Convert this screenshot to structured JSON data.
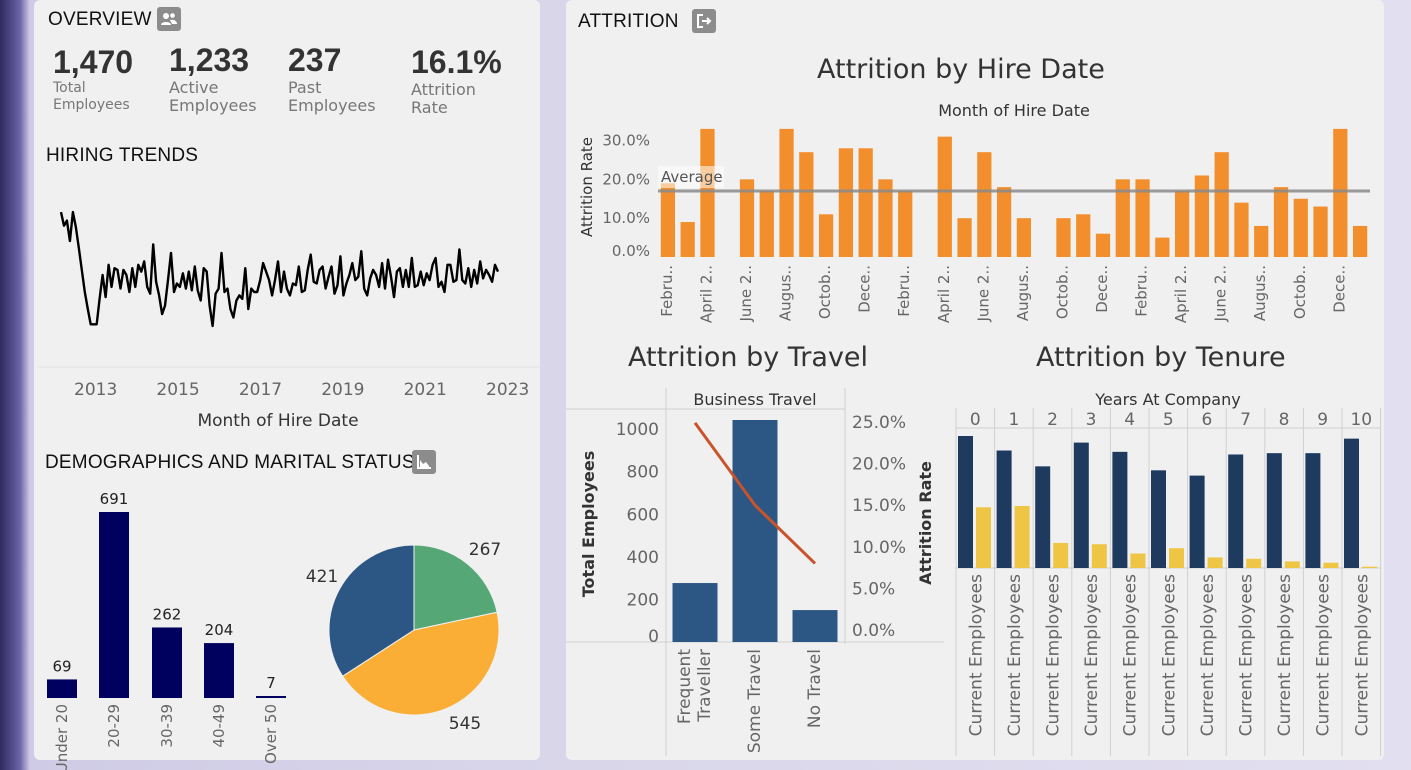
{
  "overview": {
    "title": "OVERVIEW",
    "kpis": [
      {
        "value": "1,470",
        "label_1": "Total",
        "label_2": "Employees"
      },
      {
        "value": "1,233",
        "label_1": "Active",
        "label_2": "Employees"
      },
      {
        "value": "237",
        "label_1": "Past",
        "label_2": "Employees"
      },
      {
        "value": "16.1%",
        "label_1": "Attrition",
        "label_2": "Rate"
      }
    ]
  },
  "hiring": {
    "title": "HIRING TRENDS"
  },
  "demographics": {
    "title": "DEMOGRAPHICS AND MARITAL STATUS"
  },
  "attrition": {
    "title": "ATTRITION"
  },
  "colors": {
    "orange": "#f28e2b",
    "navy": "#00005e",
    "steel": "#2c5785",
    "green": "#55a776",
    "amber": "#fbae35",
    "yellow": "#eec545",
    "line_red": "#c9532a"
  },
  "chart_data": [
    {
      "id": "hiring",
      "type": "line",
      "xlabel": "Month of Hire Date",
      "ylabel": "",
      "x_ticks": [
        "2013",
        "2015",
        "2017",
        "2019",
        "2021",
        "2023"
      ],
      "x_range": [
        2011.6,
        2023.3
      ],
      "y_range": [
        0,
        100
      ],
      "values": [
        87,
        79,
        82,
        70,
        87,
        78,
        66,
        53,
        40,
        30,
        21,
        21,
        21,
        36,
        50,
        37,
        56,
        43,
        54,
        53,
        42,
        53,
        50,
        40,
        54,
        43,
        56,
        52,
        58,
        43,
        39,
        68,
        46,
        38,
        27,
        32,
        47,
        63,
        40,
        45,
        43,
        51,
        42,
        52,
        41,
        55,
        41,
        35,
        54,
        52,
        32,
        20,
        39,
        42,
        63,
        40,
        42,
        30,
        25,
        35,
        38,
        36,
        54,
        30,
        42,
        40,
        40,
        47,
        57,
        52,
        47,
        38,
        47,
        58,
        40,
        52,
        42,
        38,
        45,
        44,
        55,
        40,
        41,
        53,
        62,
        46,
        45,
        53,
        55,
        42,
        49,
        55,
        39,
        44,
        61,
        38,
        45,
        50,
        57,
        47,
        49,
        64,
        42,
        38,
        48,
        53,
        50,
        43,
        57,
        42,
        59,
        49,
        37,
        52,
        54,
        43,
        53,
        43,
        60,
        43,
        44,
        52,
        44,
        51,
        47,
        56,
        60,
        43,
        46,
        40,
        56,
        56,
        46,
        47,
        65,
        47,
        45,
        54,
        43,
        53,
        45,
        58,
        48,
        53,
        50,
        46,
        56,
        52
      ],
      "grid": false
    },
    {
      "id": "age",
      "type": "bar",
      "categories": [
        "Under 20",
        "20-29",
        "30-39",
        "40-49",
        "Over 50"
      ],
      "values": [
        69,
        691,
        262,
        204,
        7
      ],
      "value_labels": [
        "69",
        "691",
        "262",
        "204",
        "7"
      ],
      "y_range": [
        0,
        691
      ]
    },
    {
      "id": "marital",
      "type": "pie",
      "values": [
        267,
        545,
        421
      ],
      "value_labels": [
        "267",
        "545",
        "421"
      ],
      "colors": [
        "#55a776",
        "#fbae35",
        "#2c5785"
      ]
    },
    {
      "id": "hire_attrition",
      "type": "bar",
      "title": "Attrition by Hire Date",
      "subtitle": "Month of Hire Date",
      "ylabel": "Attrition Rate",
      "y_ticks": [
        "0.0%",
        "10.0%",
        "20.0%",
        "30.0%"
      ],
      "y_range": [
        0,
        34
      ],
      "x_labels": [
        "Febru..",
        "April 2..",
        "June 2..",
        "Augus..",
        "Octob..",
        "Dece..",
        "Febru..",
        "April 2..",
        "June 2..",
        "Augus..",
        "Octob..",
        "Dece..",
        "Febru..",
        "April 2..",
        "June 2..",
        "Augus..",
        "Octob..",
        "Dece.."
      ],
      "values": [
        19,
        9,
        33,
        0,
        20,
        17,
        33,
        27,
        11,
        28,
        28,
        20,
        17,
        0,
        31,
        10,
        27,
        18,
        10,
        0,
        10,
        11,
        6,
        20,
        20,
        5,
        17,
        21,
        27,
        14,
        8,
        18,
        15,
        13,
        33,
        8
      ],
      "average": 17,
      "average_label": "Average"
    },
    {
      "id": "travel",
      "type": "bar",
      "title": "Attrition by Travel",
      "header": "Business Travel",
      "ylabel": "Total Employees",
      "ylabel_right": "Attrition Rate",
      "categories": [
        "Frequent Traveller",
        "Some Travel",
        "No Travel"
      ],
      "values": [
        277,
        1043,
        150
      ],
      "rate": [
        24.9,
        15.0,
        8.0
      ],
      "y_ticks": [
        "0",
        "200",
        "400",
        "600",
        "800",
        "1000"
      ],
      "y_range": [
        0,
        1043
      ],
      "y_ticks_right": [
        "0.0%",
        "5.0%",
        "10.0%",
        "15.0%",
        "20.0%",
        "25.0%"
      ],
      "y_range_right": [
        0,
        25
      ]
    },
    {
      "id": "tenure",
      "type": "bar",
      "title": "Attrition by Tenure",
      "header": "Years At Company",
      "categories": [
        "0",
        "1",
        "2",
        "3",
        "4",
        "5",
        "6",
        "7",
        "8",
        "9",
        "10"
      ],
      "series_labels": [
        "Current Employees",
        "Current Employees",
        "Current Employees",
        "Current Employees",
        "Current Employees",
        "Current Employees",
        "Current Employees",
        "Current Employees",
        "Current Employees",
        "Current Employees",
        "Current Employees"
      ],
      "series": [
        {
          "values": [
            100,
            89,
            77,
            95,
            88,
            74,
            70,
            86,
            87,
            87,
            98
          ]
        },
        {
          "values": [
            46,
            47,
            19,
            18,
            11,
            15,
            8,
            7,
            5,
            4,
            1
          ]
        }
      ],
      "y_range": [
        0,
        100
      ]
    }
  ]
}
